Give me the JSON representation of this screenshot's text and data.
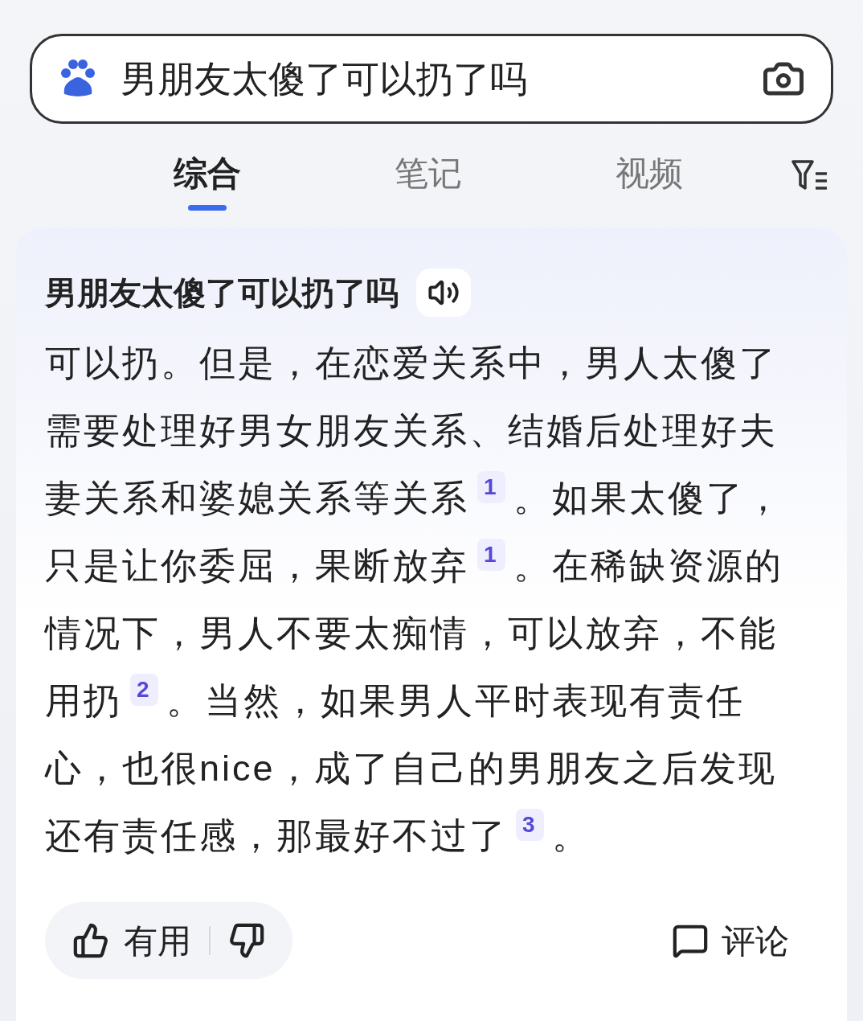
{
  "search": {
    "query": "男朋友太傻了可以扔了吗"
  },
  "tabs": [
    {
      "label": "综合",
      "selected": true
    },
    {
      "label": "笔记",
      "selected": false
    },
    {
      "label": "视频",
      "selected": false
    }
  ],
  "answer": {
    "title": "男朋友太傻了可以扔了吗",
    "segments": [
      {
        "text": "可以扔。但是，在恋爱关系中，男人太傻了需要处理好男女朋友关系、结婚后处理好夫妻关系和婆媳关系等关系",
        "cite": "1"
      },
      {
        "text": "。如果太傻了，只是让你委屈，果断放弃",
        "cite": "1"
      },
      {
        "text": "。在稀缺资源的情况下，男人不要太痴情，可以放弃，不能用扔",
        "cite": "2"
      },
      {
        "text": "。当然，如果男人平时表现有责任心，也很nice，成了自己的男朋友之后发现还有责任感，那最好不过了",
        "cite": "3"
      },
      {
        "text": "。"
      }
    ]
  },
  "footer": {
    "useful": "有用",
    "comment": "评论"
  }
}
